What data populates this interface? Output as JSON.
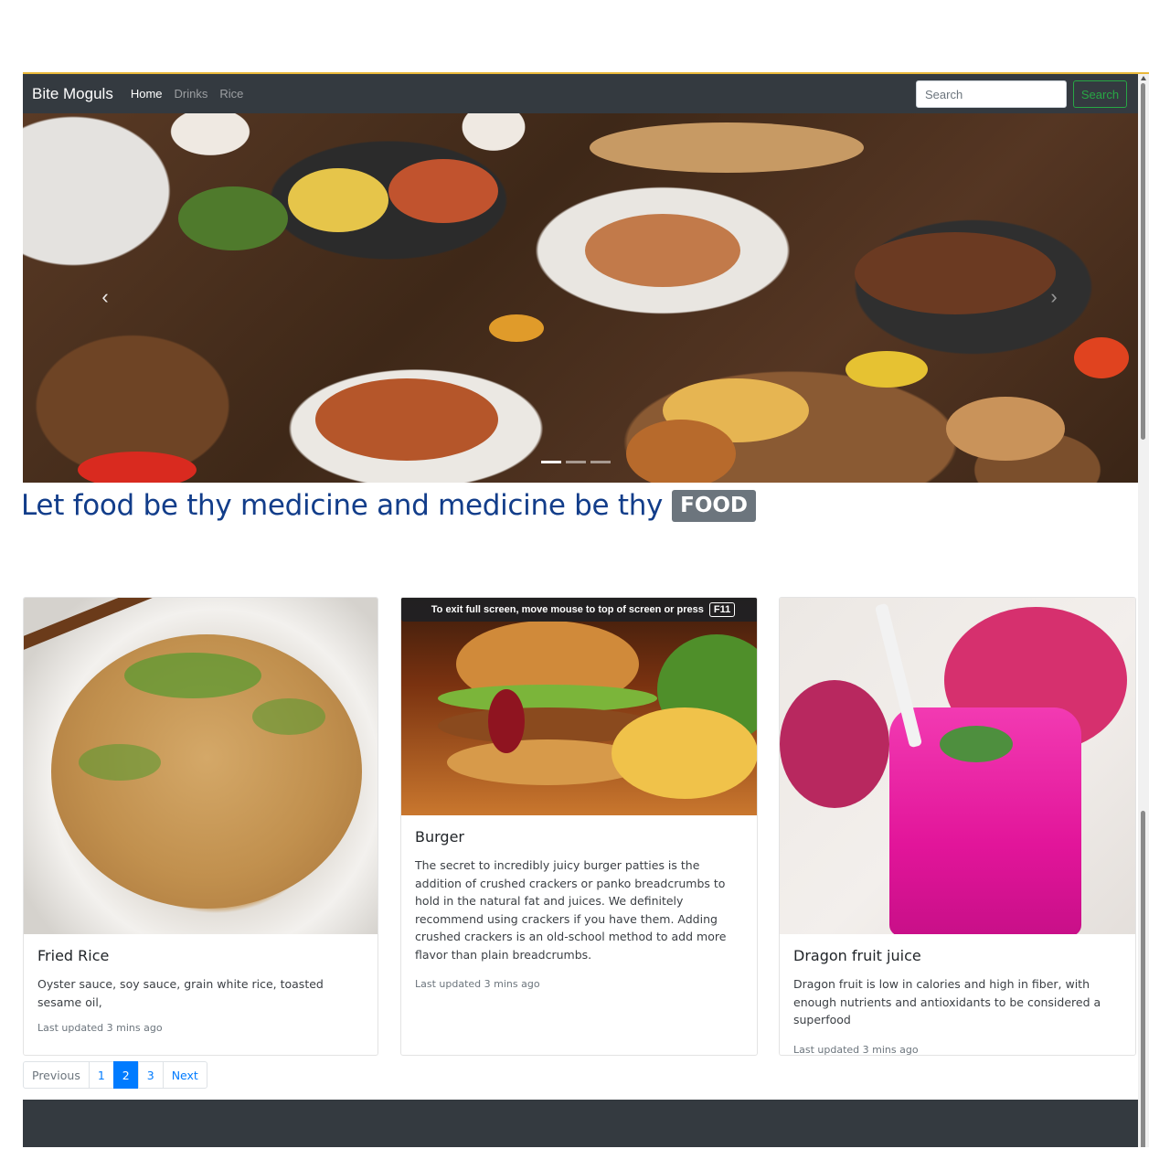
{
  "navbar": {
    "brand": "Bite Moguls",
    "links": [
      {
        "label": "Home",
        "active": true
      },
      {
        "label": "Drinks",
        "active": false
      },
      {
        "label": "Rice",
        "active": false
      }
    ],
    "search_placeholder": "Search",
    "search_button": "Search"
  },
  "carousel": {
    "prev_icon": "‹",
    "next_icon": "›",
    "slide_count": 3,
    "active_slide": 1
  },
  "headline": {
    "text": "Let food be thy medicine and medicine be thy",
    "badge": "FOOD"
  },
  "fullscreen_notice": {
    "text": "To exit full screen, move mouse to top of screen or press",
    "key": "F11"
  },
  "cards": [
    {
      "title": "Fried Rice",
      "text": "Oyster sauce, soy sauce, grain white rice, toasted sesame oil,",
      "meta": "Last updated 3 mins ago"
    },
    {
      "title": "Burger",
      "text": "The secret to incredibly juicy burger patties is the addition of crushed crackers or panko breadcrumbs to hold in the natural fat and juices. We definitely recommend using crackers if you have them. Adding crushed crackers is an old-school method to add more flavor than plain breadcrumbs.",
      "meta": "Last updated 3 mins ago"
    },
    {
      "title": "Dragon fruit juice",
      "text": "Dragon fruit is low in calories and high in fiber, with enough nutrients and antioxidants to be considered a superfood",
      "meta": "Last updated 3 mins ago"
    }
  ],
  "pagination": {
    "previous": "Previous",
    "pages": [
      "1",
      "2",
      "3"
    ],
    "active_page": "2",
    "next": "Next"
  },
  "colors": {
    "navbar_bg": "#343a40",
    "headline": "#123d8a",
    "badge_bg": "#6c757d",
    "search_button": "#28a745",
    "pagination_active": "#007bff"
  }
}
